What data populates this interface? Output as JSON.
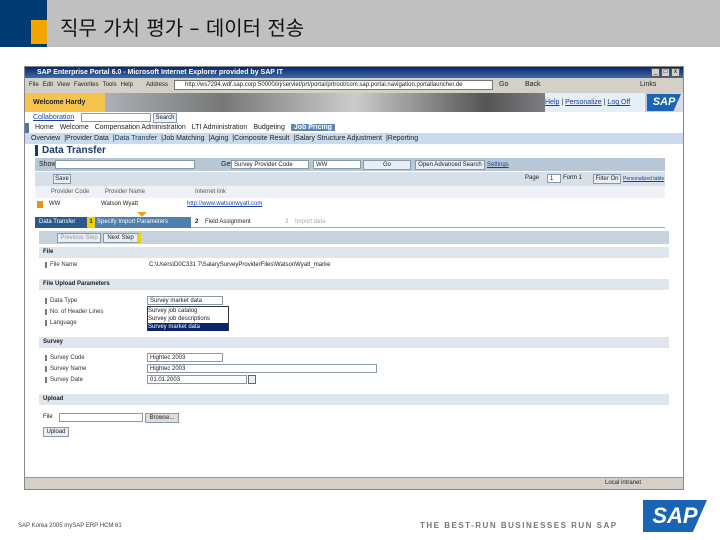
{
  "slide": {
    "title": "직무 가치 평가 – 데이터 전송",
    "footer": "SAP Korea 2005  mySAP ERP HCM  61",
    "tagline": "THE BEST-RUN BUSINESSES RUN SAP",
    "logo": "SAP"
  },
  "browser": {
    "title": "SAP Enterprise Portal 6.0 - Microsoft Internet Explorer provided by SAP IT",
    "menu": [
      "File",
      "Edit",
      "View",
      "Favorites",
      "Tools",
      "Help"
    ],
    "address_label": "Address",
    "address": "http://ws7294.wdf.sap.corp:50000/irj/servlet/prt/portal/prtroot/com.sap.portal.navigation.portallauncher.de",
    "go": "Go",
    "back": "Back",
    "links": "Links",
    "status": "Local intranet"
  },
  "portal": {
    "welcome": "Welcome Hardy Kuhn",
    "help": "Help",
    "personalize": "Personalize",
    "logoff": "Log Off",
    "collab": "Collaboration",
    "search": "Search",
    "nav": [
      "Home",
      "Welcome",
      "Compensation Administration",
      "LTI Administration",
      "Budgeting",
      "Job Pricing"
    ],
    "subnav": [
      "Overview",
      "Provider Data",
      "Data Transfer",
      "Job Matching",
      "Aging",
      "Composite Result",
      "Salary Structure Adjustment",
      "Reporting"
    ]
  },
  "page": {
    "title": "Data Transfer",
    "show": "Show",
    "get": "Get",
    "get_field": "Survey Provider Code",
    "get_value": "WW",
    "go": "Go",
    "adv": "Open Advanced Search",
    "settings": "Settings",
    "save": "Save",
    "page": "Page",
    "page_val": "1",
    "page_of": "Form 1",
    "filter": "Filter On",
    "personalize": "Personalized table",
    "cols": [
      "Provider Code",
      "Provider Name",
      "Internet link"
    ],
    "row": [
      "WW",
      "Watson Wyatt",
      "http://www.watsonwyatt.com"
    ],
    "roadmap": [
      "Data Transfer",
      "1",
      "Specify Import Parameters",
      "2",
      "Field Assignment",
      "3",
      "Import data"
    ],
    "prev": "Previous Step",
    "next": "Next Step",
    "file_h": "File",
    "file_lbl": "File Name",
    "file_val": "C:\\Users\\D0C331 7\\SalarySurveyProviderFiles\\WatsonWyatt_marke",
    "fup_h": "File Upload Parameters",
    "dt_lbl": "Data Type",
    "dt_val": "Survey market data",
    "hl_lbl": "No. of Header Lines",
    "lang_lbl": "Language",
    "dt_options": [
      "Survey job catalog",
      "Survey job descriptions",
      "Survey market data"
    ],
    "survey_h": "Survey",
    "sc_lbl": "Survey Code",
    "sc_val": "Hightec 2003",
    "sn_lbl": "Survey Name",
    "sn_val": "Hightec 2003",
    "sd_lbl": "Survey Date",
    "sd_val": "01.01.2003",
    "upload_h": "Upload",
    "ufile": "File",
    "browse": "Browse...",
    "upload": "Upload"
  }
}
